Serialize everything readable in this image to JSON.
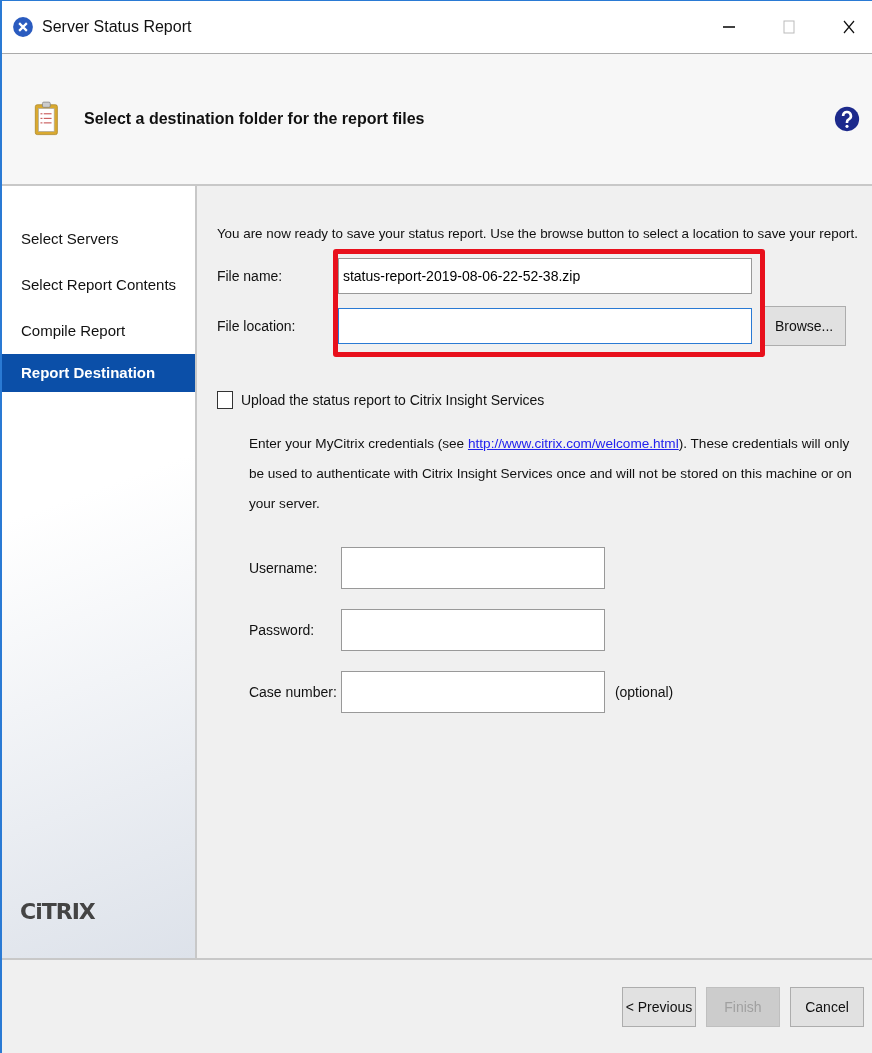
{
  "window": {
    "title": "Server Status Report"
  },
  "header": {
    "title": "Select a destination folder for the report files"
  },
  "sidebar": {
    "items": [
      {
        "label": "Select Servers",
        "selected": false
      },
      {
        "label": "Select Report Contents",
        "selected": false
      },
      {
        "label": "Compile Report",
        "selected": false
      },
      {
        "label": "Report Destination",
        "selected": true
      }
    ],
    "logo": "CiTRIX"
  },
  "intro": "You are now ready to save your status report. Use the browse button to select a location to save your report.",
  "file_name": {
    "label": "File name:",
    "value": "status-report-2019-08-06-22-52-38.zip"
  },
  "file_location": {
    "label": "File location:",
    "focused": true
  },
  "browse_button": "Browse...",
  "upload": {
    "label": "Upload the status report to Citrix Insight Services",
    "checked": false
  },
  "credentials_note": {
    "before": "Enter your MyCitrix credentials (see ",
    "link": "http://www.citrix.com/welcome.html",
    "after": "). These credentials will only be used to authenticate with Citrix Insight Services once and will not be stored on this machine or on your server."
  },
  "credential_fields": [
    {
      "label": "Username:"
    },
    {
      "label": "Password:"
    },
    {
      "label": "Case number:",
      "hint": "(optional)"
    }
  ],
  "buttons": [
    {
      "label": "< Previous",
      "disabled": false
    },
    {
      "label": "Finish",
      "disabled": true
    },
    {
      "label": "Cancel",
      "disabled": false
    }
  ]
}
